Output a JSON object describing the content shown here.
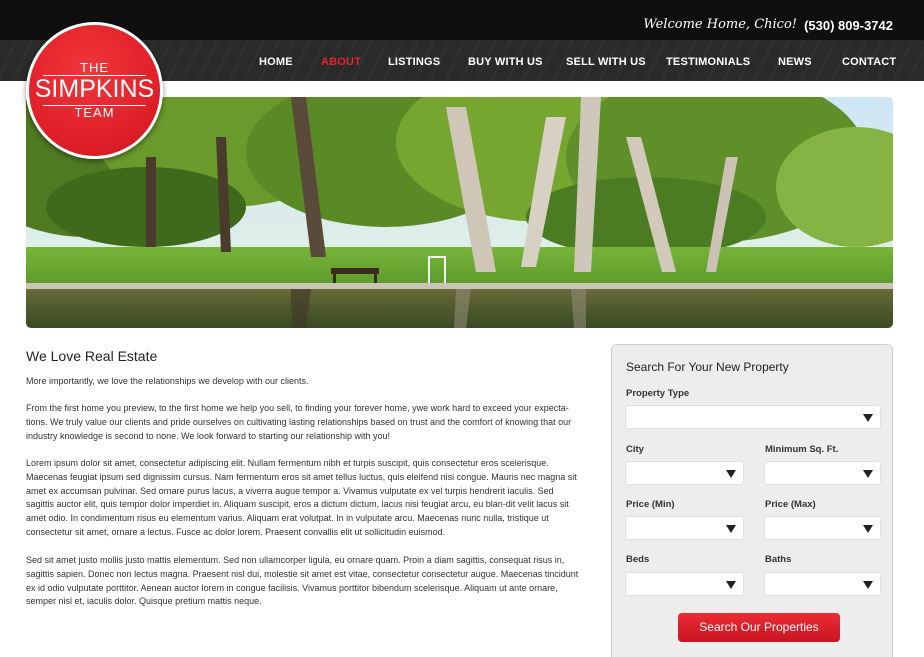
{
  "header": {
    "welcome": "Welcome Home, Chico!",
    "phone": "(530) 809-3742",
    "logo": {
      "line1": "THE",
      "line2": "SIMPKINS",
      "line3": "TEAM"
    },
    "nav": [
      "HOME",
      "ABOUT",
      "LISTINGS",
      "BUY WITH US",
      "SELL WITH US",
      "TESTIMONIALS",
      "NEWS",
      "CONTACT"
    ],
    "active_nav": "ABOUT"
  },
  "hero": {
    "icon": "park-pond-photo"
  },
  "content": {
    "title": "We Love Real Estate",
    "paragraphs": [
      "More importantly, we love the relationships we develop with our clients.",
      "From the first home you preview, to the first home we help you sell, to finding your forever home, ywe work hard to exceed your expecta-tions. We truly value our clients and pride ourselves on cultivating lasting relationships based on trust and the comfort of knowing that our industry knowledge is second to none. We look forward to starting our relationship with you!",
      "Lorem ipsum dolor sit amet, consectetur adipiscing elit. Nullam fermentum nibh et turpis suscipit, quis consectetur eros scelerisque. Maecenas feugiat ipsum sed dignissim cursus. Nam fermentum eros sit amet tellus luctus, quis eleifend nisi congue. Mauris nec magna sit amet ex accumsan pulvinar. Sed ornare purus lacus, a viverra augue tempor a. Vivamus vulputate ex vel turpis hendrerit iaculis. Sed sagittis auctor elit, quis tempor dolor imperdiet in. Aliquam suscipit, eros a dictum dictum, lacus nisi feugiat arcu, eu blan-dit velit lacus sit amet odio. In condimentum risus eu elementum varius. Aliquam erat volutpat. In in vulputate arcu. Maecenas nunc nulla, tristique ut consectetur sit amet, ornare a lectus. Fusce ac dolor lorem. Praesent convallis elit ut sollicitudin euismod.",
      "Sed sit amet justo mollis justo mattis elementum. Sed non ullamcorper ligula, eu ornare quam. Proin a diam sagittis, consequat risus in, sagittis sapien. Donec non lectus magna. Praesent nisl dui, molestie sit amet est vitae, consectetur consectetur augue. Maecenas tincidunt ex id odio vulputate porttitor. Aenean auctor lorem in congue facilisis. Vivamus porttitor bibendum scelerisque. Aliquam ut ante ornare, semper nisl et, iaculis dolor. Quisque pretium mattis neque."
    ]
  },
  "search": {
    "title": "Search For Your New Property",
    "fields": {
      "property_type": "Property Type",
      "city": "City",
      "min_sqft": "Minimum Sq. Ft.",
      "price_min": "Price (Min)",
      "price_max": "Price (Max)",
      "beds": "Beds",
      "baths": "Baths"
    },
    "button": "Search Our Properties"
  },
  "colors": {
    "accent": "#e8222e",
    "dark": "#1a1a1a"
  }
}
